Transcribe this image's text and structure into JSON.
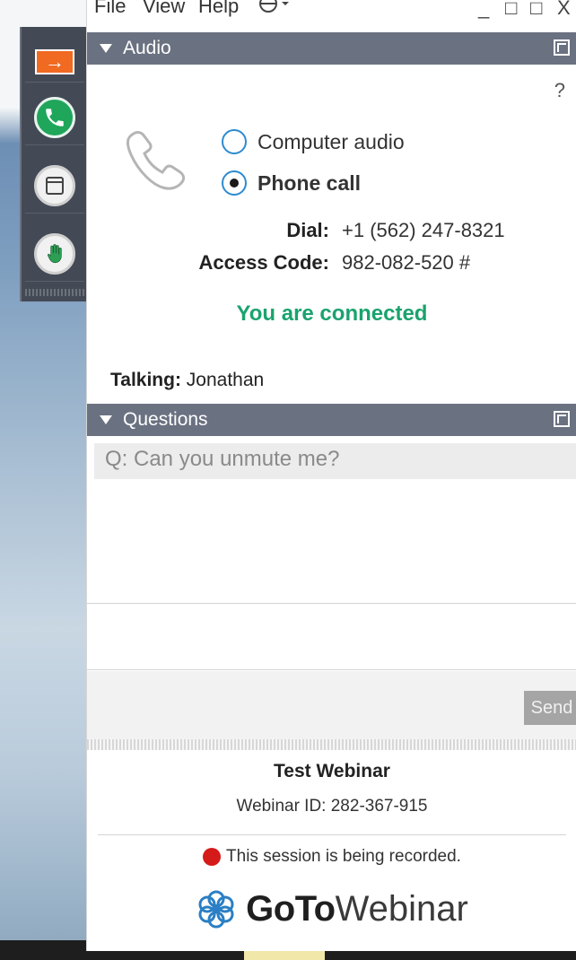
{
  "menu": {
    "file": "File",
    "view": "View",
    "help": "Help"
  },
  "window_controls": {
    "minimize": "_",
    "restore": "□",
    "maximize": "□",
    "close": "X"
  },
  "audio": {
    "title": "Audio",
    "help": "?",
    "options": [
      {
        "label": "Computer audio",
        "selected": false
      },
      {
        "label": "Phone call",
        "selected": true
      }
    ],
    "dial_label": "Dial:",
    "dial_value": "+1 (562) 247-8321",
    "access_label": "Access Code:",
    "access_value": "982-082-520 #",
    "status": "You are connected",
    "talking_label": "Talking:",
    "talking_name": "Jonathan"
  },
  "questions": {
    "title": "Questions",
    "items": [
      "Q: Can you unmute me?"
    ],
    "send_label": "Send"
  },
  "footer": {
    "webinar_title": "Test Webinar",
    "webinar_id": "Webinar ID: 282-367-915",
    "recording_text": "This session is being recorded.",
    "brand_bold": "GoTo",
    "brand_light": "Webinar"
  },
  "colors": {
    "header": "#6a7181",
    "accent_orange": "#f06a22",
    "connected_green": "#1aa36e",
    "phone_green": "#1fa65a",
    "record_red": "#d51a1a"
  },
  "icons": [
    "arrow-right-icon",
    "phone-icon",
    "screen-icon",
    "raise-hand-icon",
    "handset-icon",
    "popout-icon",
    "language-icon",
    "gotowebinar-flower-icon"
  ]
}
